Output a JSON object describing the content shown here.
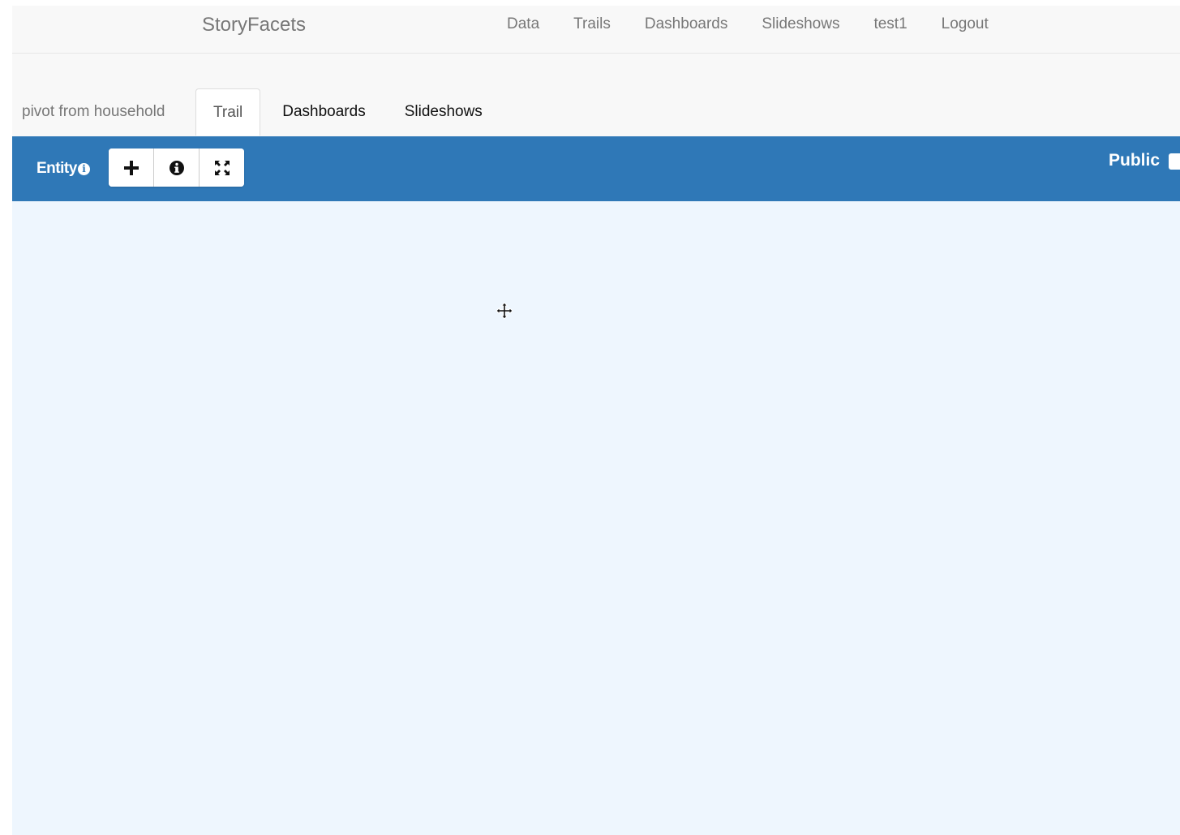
{
  "navbar": {
    "brand": "StoryFacets",
    "links": [
      "Data",
      "Trails",
      "Dashboards",
      "Slideshows",
      "test1",
      "Logout"
    ]
  },
  "trail": {
    "title": "pivot from household",
    "tabs": [
      {
        "label": "Trail",
        "active": true
      },
      {
        "label": "Dashboards",
        "active": false
      },
      {
        "label": "Slideshows",
        "active": false
      }
    ]
  },
  "toolbar": {
    "entity_label": "Entity",
    "entity_info_icon": "info-circle-icon",
    "buttons": [
      {
        "icon": "plus-icon"
      },
      {
        "icon": "info-circle-icon"
      },
      {
        "icon": "fullscreen-icon"
      }
    ],
    "public_label": "Public",
    "public_checked": false
  },
  "colors": {
    "navbar_bg": "#f8f8f8",
    "toolbar_bg": "#2f78b7",
    "canvas_bg": "#eef6fe"
  },
  "cursor": {
    "icon": "move-cursor-icon"
  }
}
